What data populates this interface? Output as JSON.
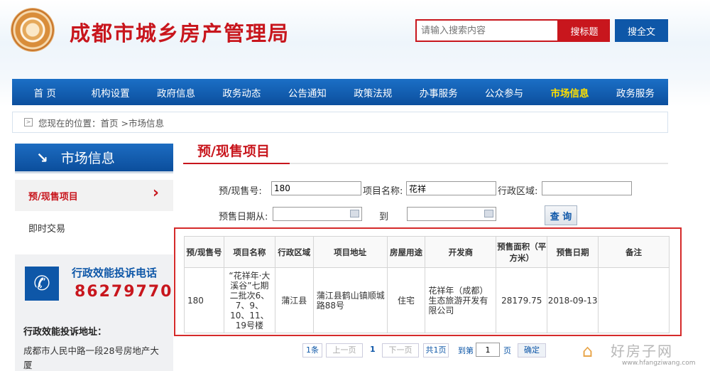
{
  "header": {
    "site_title": "成都市城乡房产管理局",
    "search_placeholder": "请输入搜索内容",
    "search_title_btn": "搜标题",
    "search_all_btn": "搜全文"
  },
  "nav": [
    {
      "label": "首  页"
    },
    {
      "label": "机构设置"
    },
    {
      "label": "政府信息"
    },
    {
      "label": "政务动态"
    },
    {
      "label": "公告通知"
    },
    {
      "label": "政策法规"
    },
    {
      "label": "办事服务"
    },
    {
      "label": "公众参与"
    },
    {
      "label": "市场信息"
    },
    {
      "label": "政务服务"
    }
  ],
  "breadcrumb": "您现在的位置：首页 >市场信息",
  "sidebar": {
    "title": "市场信息",
    "items": [
      {
        "label": "预/现售项目"
      },
      {
        "label": "即时交易"
      }
    ],
    "complaint_label": "行政效能投诉电话",
    "complaint_phone": "86279770",
    "address_label": "行政效能投诉地址：",
    "address": "成都市人民中路一段28号房地产大厦"
  },
  "main": {
    "title": "预/现售项目",
    "form": {
      "presale_no_label": "预/现售号:",
      "presale_no_value": "180",
      "project_name_label": "项目名称:",
      "project_name_value": "花祥",
      "district_label": "行政区域:",
      "district_value": "",
      "date_from_label": "预售日期从:",
      "date_from_value": "",
      "date_to_label": "到",
      "date_to_value": "",
      "query_btn": "查 询"
    },
    "table": {
      "headers": [
        "预/现售号",
        "项目名称",
        "行政区域",
        "项目地址",
        "房屋用途",
        "开发商",
        "预售面积（平方米）",
        "预售日期",
        "备注"
      ],
      "rows": [
        [
          "180",
          "“花祥年·大溪谷”七期二批次6、7、9、10、11、19号楼",
          "蒲江县",
          "蒲江县鹤山镇顺城路88号",
          "住宅",
          "花祥年（成都）生态旅游开发有限公司",
          "28179.75",
          "2018-09-13",
          ""
        ]
      ]
    },
    "pagination": {
      "count": "1条",
      "prev": "上一页",
      "current": "1",
      "next": "下一页",
      "total": "共1页",
      "goto_label": "到第",
      "goto_value": "1",
      "page_unit": "页",
      "confirm": "确定"
    }
  },
  "watermark": {
    "text": "好房子网",
    "url": "www.hfangziwang.com"
  }
}
